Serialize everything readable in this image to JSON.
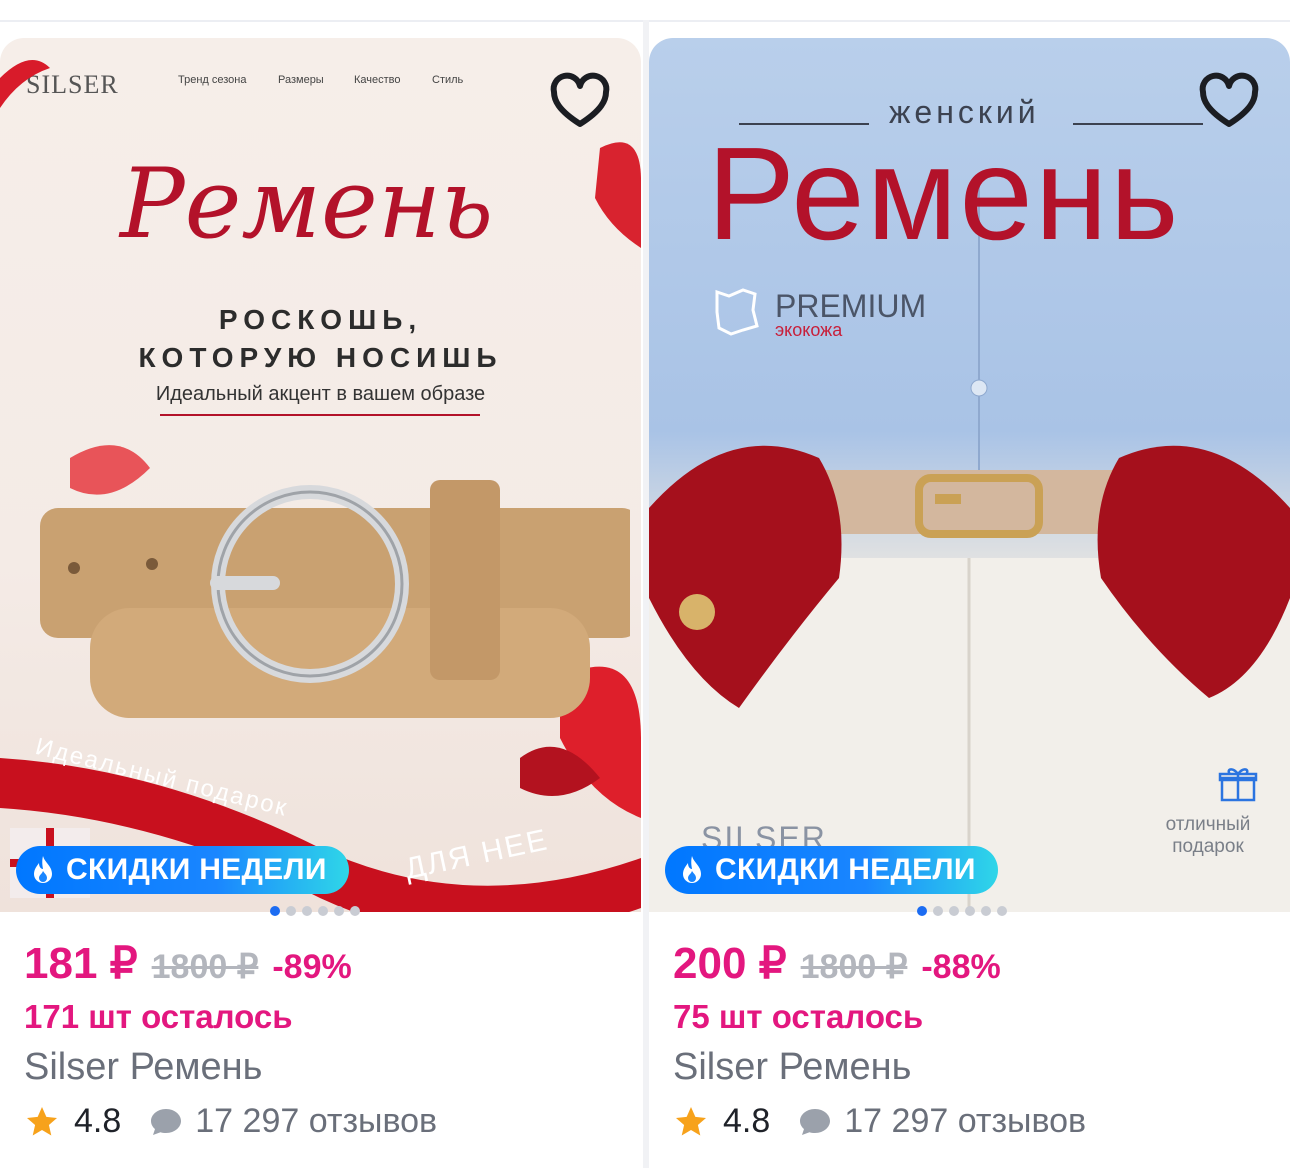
{
  "products": [
    {
      "price": "181 ₽",
      "old_price": "1800 ₽",
      "discount": "-89%",
      "stock": "171 шт осталось",
      "title": "Silser Ремень",
      "rating": "4.8",
      "reviews": "17 297 отзывов",
      "badge": "СКИДКИ НЕДЕЛИ",
      "banner": {
        "logo": "SILSER",
        "nav": [
          "Тренд сезона",
          "Размеры",
          "Качество",
          "Стиль"
        ],
        "script_title": "Ремень",
        "headline_1": "РОСКОШЬ,",
        "headline_2": "КОТОРУЮ НОСИШЬ",
        "subline": "Идеальный акцент в вашем образе",
        "ribbon_1": "Идеальный подарок",
        "ribbon_2": "ДЛЯ НЕЕ"
      }
    },
    {
      "price": "200 ₽",
      "old_price": "1800 ₽",
      "discount": "-88%",
      "stock": "75 шт осталось",
      "title": "Silser Ремень",
      "rating": "4.8",
      "reviews": "17 297 отзывов",
      "badge": "СКИДКИ НЕДЕЛИ",
      "banner": {
        "subtitle": "женский",
        "title": "Ремень",
        "premium": "PREMIUM",
        "eco": "экокожа",
        "brand": "SILSER",
        "gift_line_1": "отличный",
        "gift_line_2": "подарок"
      }
    }
  ],
  "colors": {
    "price": "#e3177f",
    "old_price": "#b3b6bd",
    "badge_start": "#0077ff",
    "badge_end": "#2fd6e8",
    "star": "#f7a21b",
    "dot_active": "#1c6cf2"
  },
  "icons": [
    "heart-icon",
    "fire-icon",
    "star-icon",
    "chat-bubble-icon",
    "gift-icon",
    "leather-icon"
  ],
  "carousel": {
    "total": 6,
    "active": 1
  }
}
